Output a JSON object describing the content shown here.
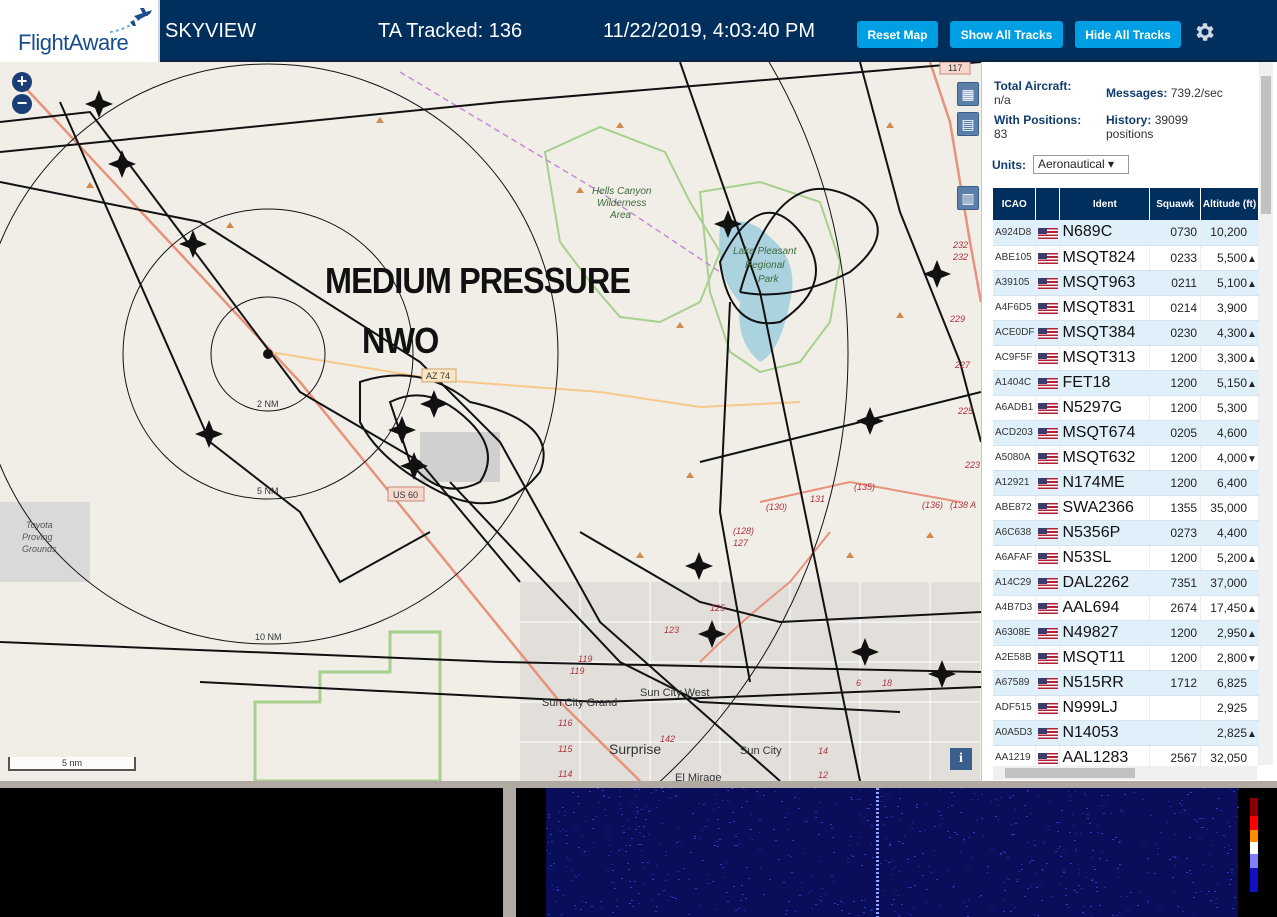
{
  "header": {
    "logo_text": "FlightAware",
    "site_name": "SKYVIEW",
    "ta_tracked": "TA Tracked: 136",
    "datetime": "11/22/2019, 4:03:40 PM",
    "reset_label": "Reset Map",
    "show_label": "Show All Tracks",
    "hide_label": "Hide All Tracks",
    "accent_color": "#009fe3",
    "bar_color": "#002f5d"
  },
  "map": {
    "overlay_line1": "MEDIUM PRESSURE",
    "overlay_line2": "NWO",
    "labels": {
      "hells_canyon": "Hells Canyon",
      "wilderness": "Wilderness",
      "area": "Area",
      "lake_pleasant": "Lake Pleasant",
      "regional": "Regional",
      "park": "Park",
      "tovota": "Toyota",
      "proving": "Proving",
      "grounds": "Grounds",
      "sun_city_west": "Sun City West",
      "sun_city_grand": "Sun City Grand",
      "surprise": "Surprise",
      "sun_city": "Sun City",
      "el_mirage": "El Mirage",
      "az74": "AZ 74",
      "us60": "US 60",
      "ring_2nm": "2 NM",
      "ring_5nm": "5 NM",
      "ring_10nm": "10 NM",
      "r130": "(130)",
      "r131": "131",
      "r135": "(135)",
      "r136": "(136)",
      "r138": "(138 A",
      "r128": "(128)",
      "r127": "127",
      "r125": "125",
      "r123": "123",
      "r119a": "119",
      "r119b": "119",
      "r116": "116",
      "r115": "115",
      "r114": "114",
      "r142": "142",
      "r14": "14",
      "r12": "12",
      "r18": "18",
      "r16": "6",
      "r232a": "232",
      "r232b": "232",
      "r229": "229",
      "r227": "227",
      "r225": "225",
      "r223": "223",
      "rt117": "117"
    },
    "scale_label": "5 nm",
    "info_label": "i"
  },
  "stats": {
    "total_aircraft_label": "Total Aircraft:",
    "total_aircraft_value": "n/a",
    "with_positions_label": "With Positions:",
    "with_positions_value": "83",
    "messages_label": "Messages:",
    "messages_value": "739.2/sec",
    "history_label": "History:",
    "history_value": "39099",
    "history_unit": "positions",
    "units_label": "Units:",
    "units_value": "Aeronautical"
  },
  "table": {
    "headers": [
      "ICAO",
      "",
      "Ident",
      "Squawk",
      "Altitude (ft)"
    ],
    "rows": [
      {
        "icao": "A924D8",
        "ident": "N689C",
        "squawk": "0730",
        "alt": "10,200",
        "trend": ""
      },
      {
        "icao": "ABE105",
        "ident": "MSQT824",
        "squawk": "0233",
        "alt": "5,500",
        "trend": "▲"
      },
      {
        "icao": "A39105",
        "ident": "MSQT963",
        "squawk": "0211",
        "alt": "5,100",
        "trend": "▲"
      },
      {
        "icao": "A4F6D5",
        "ident": "MSQT831",
        "squawk": "0214",
        "alt": "3,900",
        "trend": ""
      },
      {
        "icao": "ACE0DF",
        "ident": "MSQT384",
        "squawk": "0230",
        "alt": "4,300",
        "trend": "▲"
      },
      {
        "icao": "AC9F5F",
        "ident": "MSQT313",
        "squawk": "1200",
        "alt": "3,300",
        "trend": "▲"
      },
      {
        "icao": "A1404C",
        "ident": "FET18",
        "squawk": "1200",
        "alt": "5,150",
        "trend": "▲"
      },
      {
        "icao": "A6ADB1",
        "ident": "N5297G",
        "squawk": "1200",
        "alt": "5,300",
        "trend": ""
      },
      {
        "icao": "ACD203",
        "ident": "MSQT674",
        "squawk": "0205",
        "alt": "4,600",
        "trend": ""
      },
      {
        "icao": "A5080A",
        "ident": "MSQT632",
        "squawk": "1200",
        "alt": "4,000",
        "trend": "▼"
      },
      {
        "icao": "A12921",
        "ident": "N174ME",
        "squawk": "1200",
        "alt": "6,400",
        "trend": ""
      },
      {
        "icao": "ABE872",
        "ident": "SWA2366",
        "squawk": "1355",
        "alt": "35,000",
        "trend": ""
      },
      {
        "icao": "A6C638",
        "ident": "N5356P",
        "squawk": "0273",
        "alt": "4,400",
        "trend": ""
      },
      {
        "icao": "A6AFAF",
        "ident": "N53SL",
        "squawk": "1200",
        "alt": "5,200",
        "trend": "▲"
      },
      {
        "icao": "A14C29",
        "ident": "DAL2262",
        "squawk": "7351",
        "alt": "37,000",
        "trend": ""
      },
      {
        "icao": "A4B7D3",
        "ident": "AAL694",
        "squawk": "2674",
        "alt": "17,450",
        "trend": "▲"
      },
      {
        "icao": "A6308E",
        "ident": "N49827",
        "squawk": "1200",
        "alt": "2,950",
        "trend": "▲"
      },
      {
        "icao": "A2E58B",
        "ident": "MSQT11",
        "squawk": "1200",
        "alt": "2,800",
        "trend": "▼"
      },
      {
        "icao": "A67589",
        "ident": "N515RR",
        "squawk": "1712",
        "alt": "6,825",
        "trend": ""
      },
      {
        "icao": "ADF515",
        "ident": "N999LJ",
        "squawk": "",
        "alt": "2,925",
        "trend": ""
      },
      {
        "icao": "A0A5D3",
        "ident": "N14053",
        "squawk": "",
        "alt": "2,825",
        "trend": "▲"
      },
      {
        "icao": "AA1219",
        "ident": "AAL1283",
        "squawk": "2567",
        "alt": "32,050",
        "trend": ""
      }
    ]
  },
  "icons": {
    "gear": "gear-icon",
    "zoom_in": "+",
    "zoom_out": "−",
    "map_toggle": "map-icon",
    "grid_toggle": "grid-icon",
    "column_toggle": "columns-icon"
  }
}
